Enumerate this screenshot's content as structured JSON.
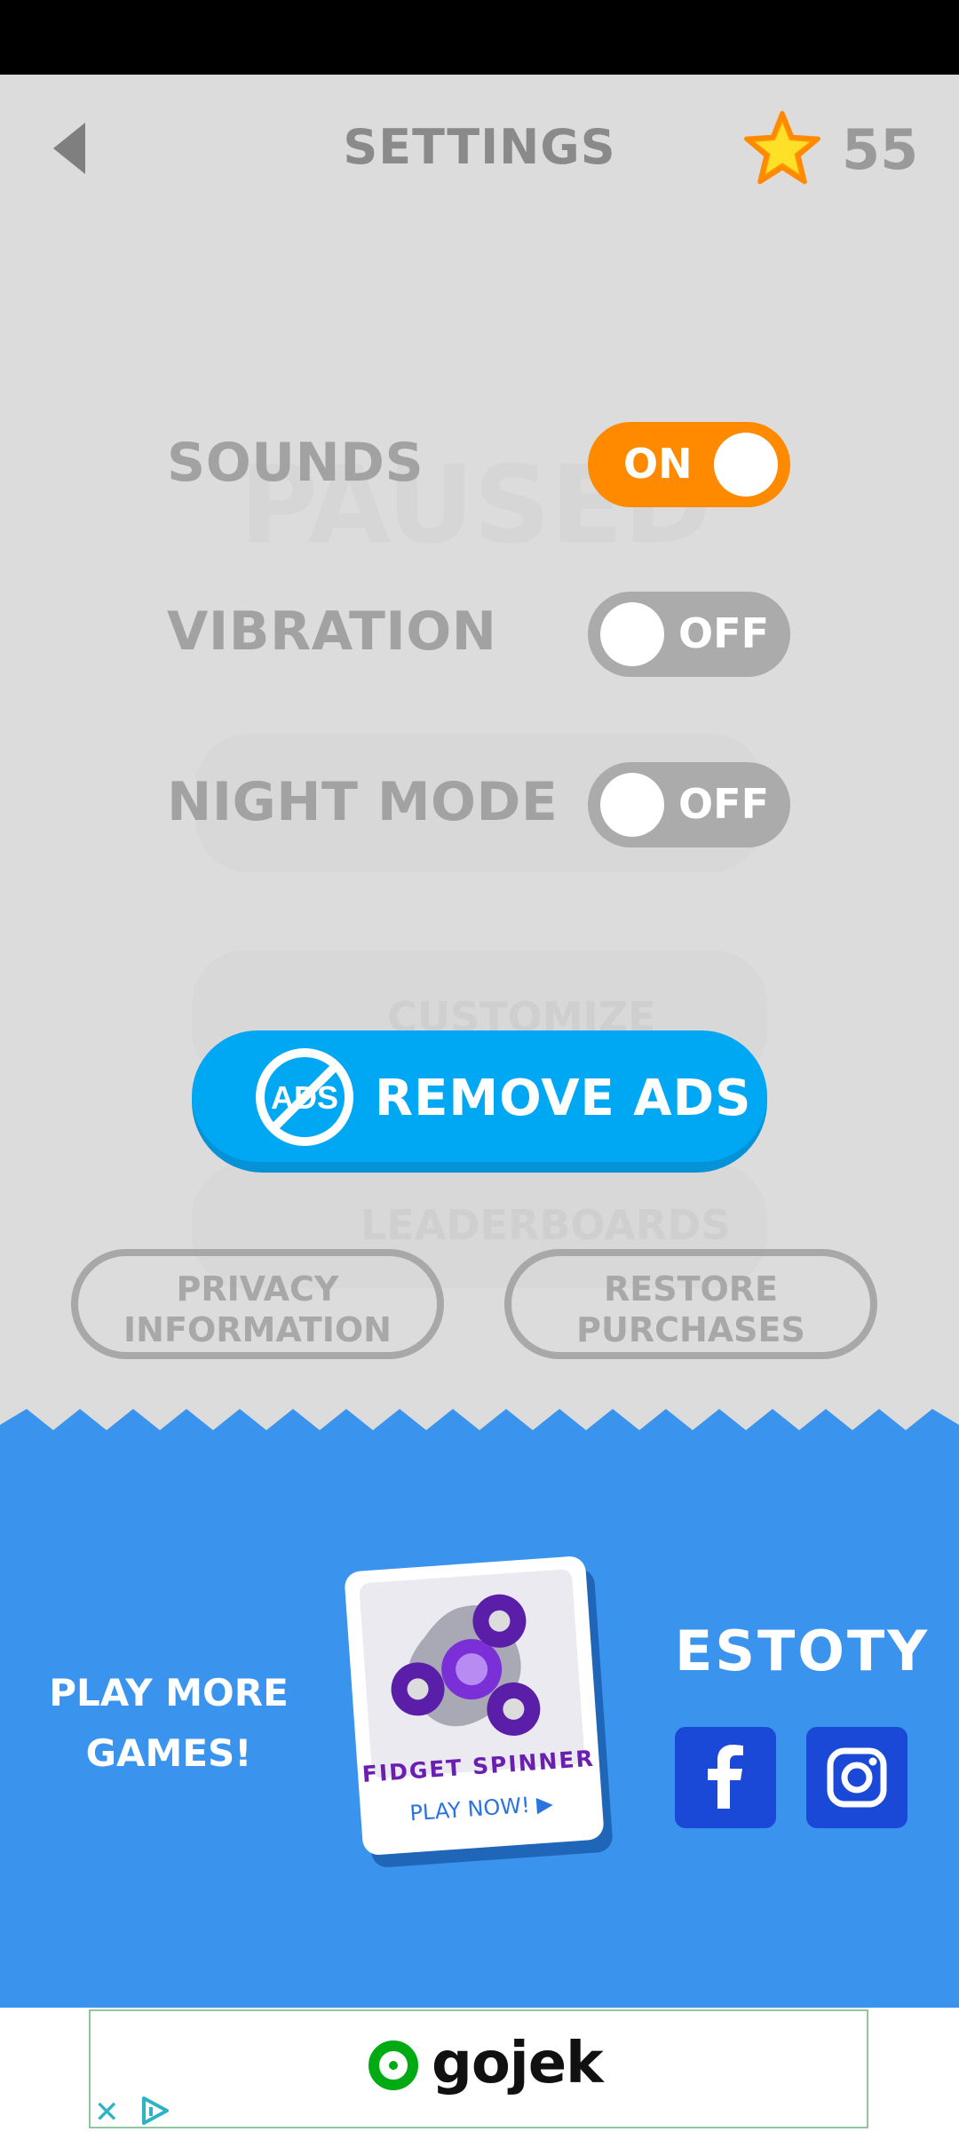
{
  "header": {
    "title": "SETTINGS",
    "coins": "55"
  },
  "background_text": {
    "paused": "PAUSED",
    "customize": "CUSTOMIZE",
    "leaderboards": "LEADERBOARDS"
  },
  "settings": [
    {
      "label": "SOUNDS",
      "state": "ON"
    },
    {
      "label": "VIBRATION",
      "state": "OFF"
    },
    {
      "label": "NIGHT MODE",
      "state": "OFF"
    }
  ],
  "remove_ads": {
    "icon_text": "ADS",
    "label": "REMOVE ADS"
  },
  "buttons": {
    "privacy_line1": "PRIVACY",
    "privacy_line2": "INFORMATION",
    "restore_line1": "RESTORE",
    "restore_line2": "PURCHASES"
  },
  "promo": {
    "play_more_line1": "PLAY MORE",
    "play_more_line2": "GAMES!",
    "card_title": "FIDGET SPINNER",
    "card_cta": "PLAY NOW!",
    "brand": "ESTOTY"
  },
  "ad": {
    "brand": "gojek",
    "close": "✕"
  },
  "colors": {
    "accent_on": "#ff8a00",
    "toggle_off": "#ababab",
    "remove_ads": "#00a8f4",
    "promo_blue": "#3a93ec",
    "social": "#1a49d8"
  },
  "icons": [
    "back-arrow-icon",
    "star-icon",
    "no-ads-icon",
    "facebook-icon",
    "instagram-icon",
    "gojek-logo-icon",
    "ad-close-icon",
    "ad-choices-icon"
  ]
}
